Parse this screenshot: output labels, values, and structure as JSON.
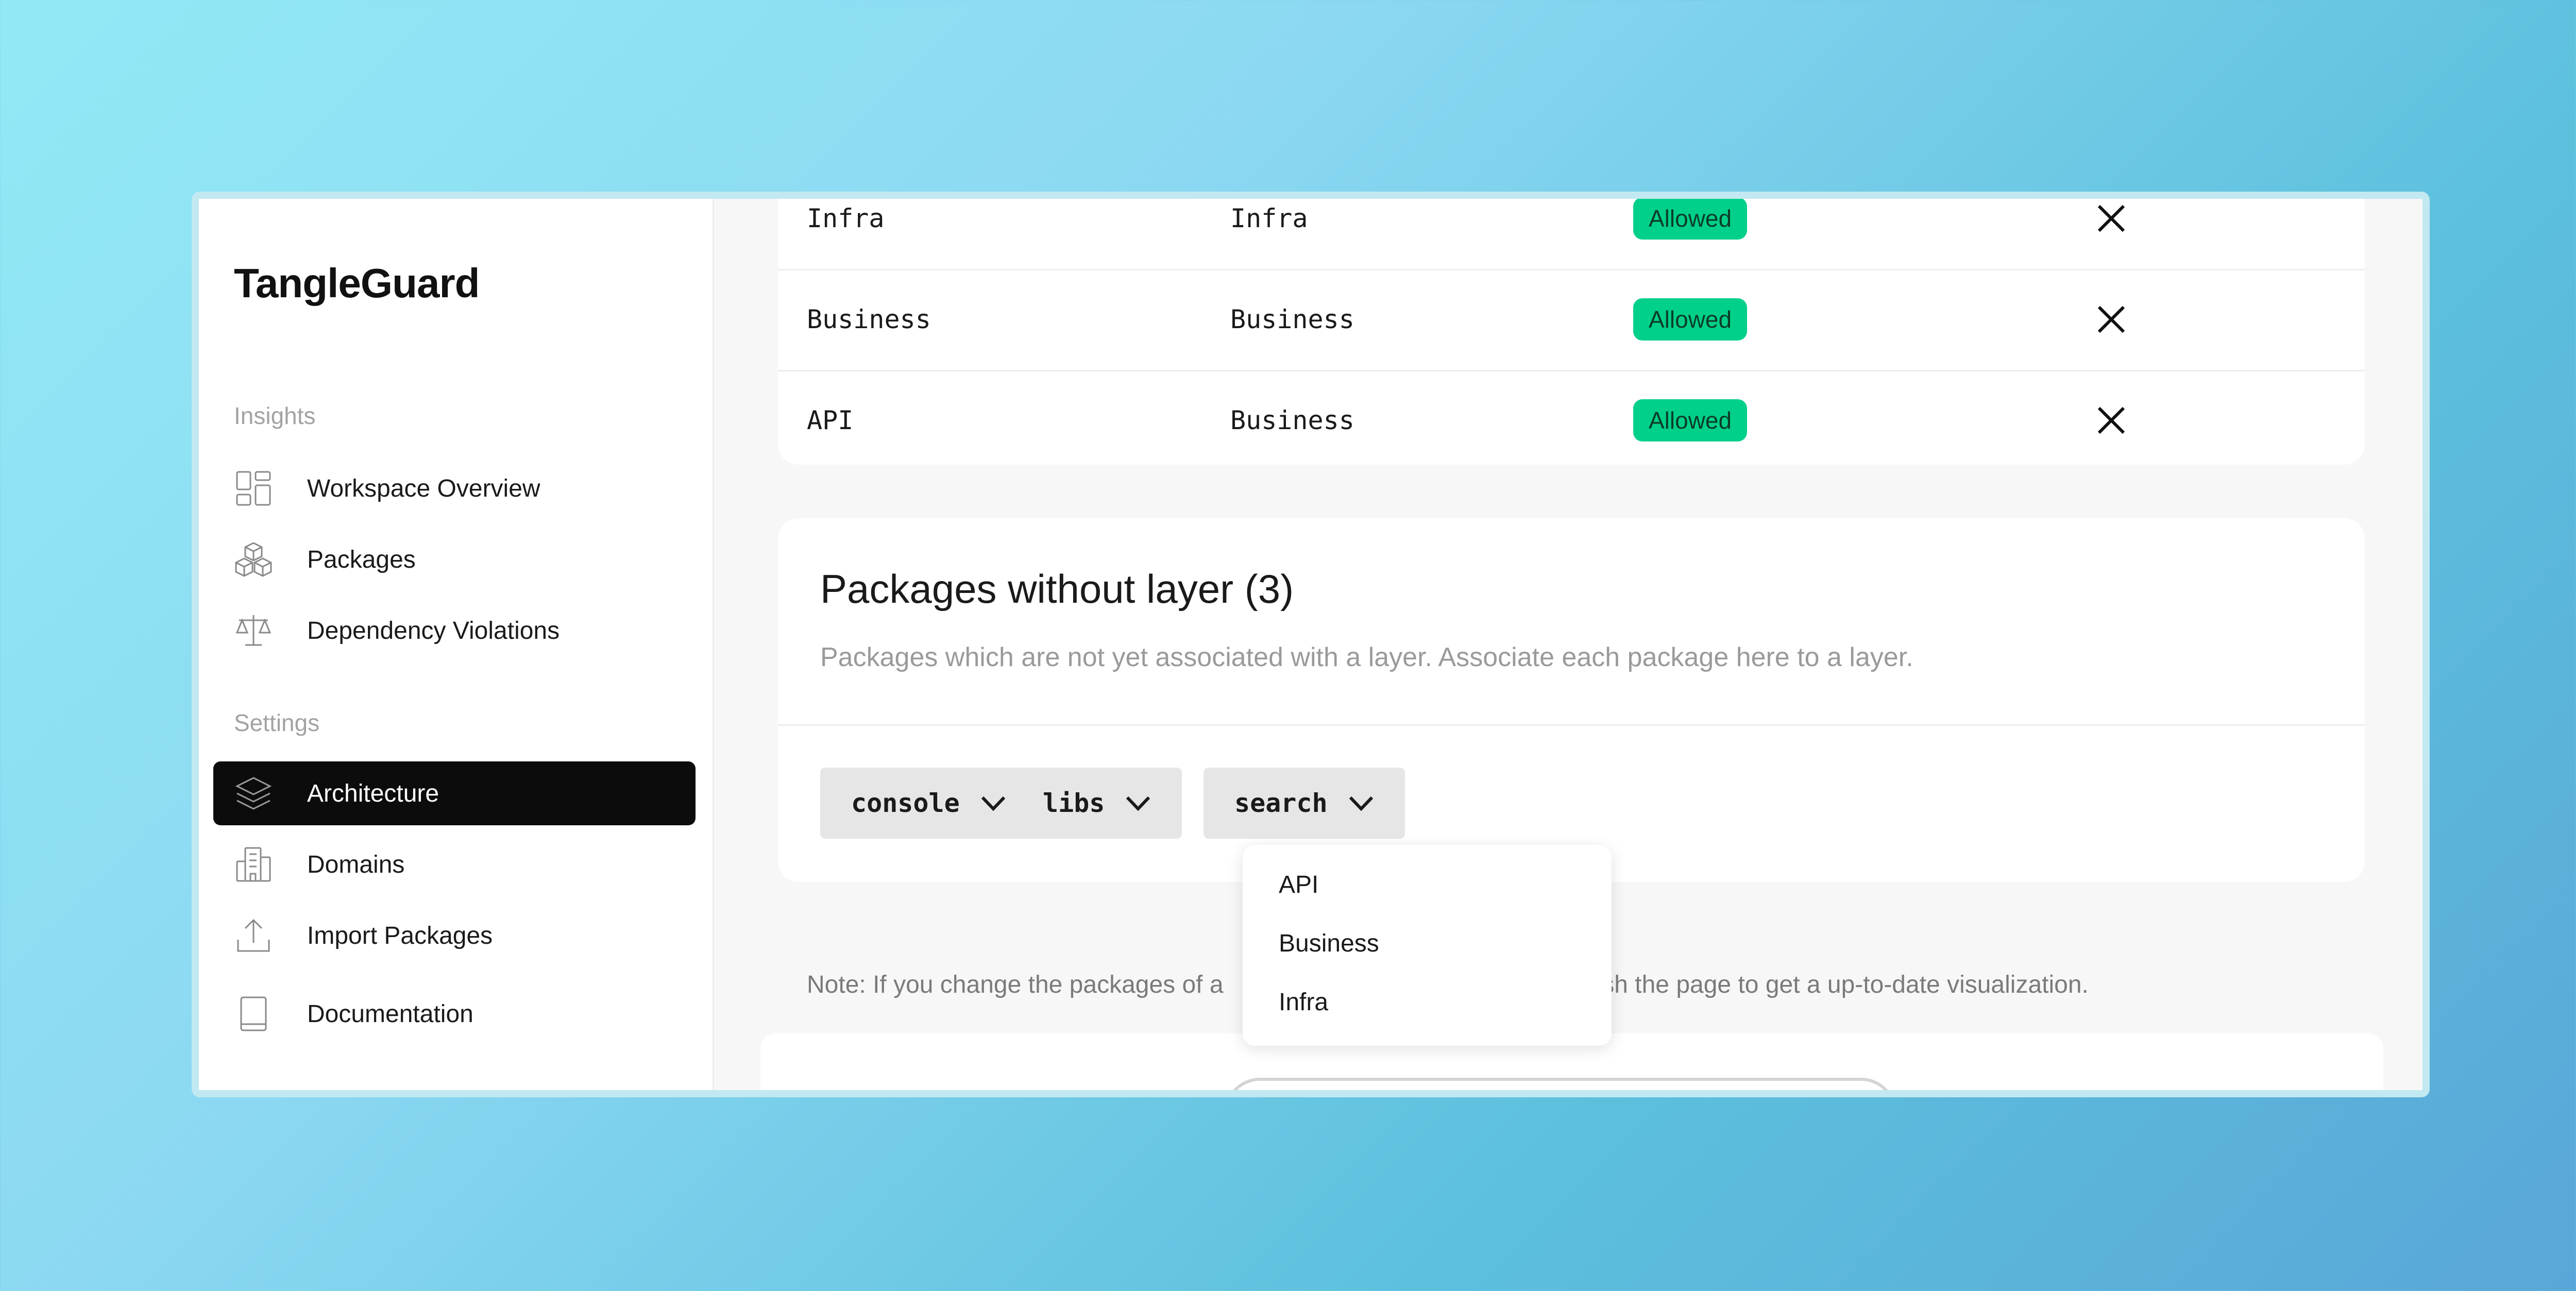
{
  "app": {
    "name": "TangleGuard"
  },
  "sidebar": {
    "sections": [
      {
        "title": "Insights",
        "items": [
          {
            "label": "Workspace Overview",
            "icon": "grid-layout-icon"
          },
          {
            "label": "Packages",
            "icon": "cubes-icon"
          },
          {
            "label": "Dependency Violations",
            "icon": "scale-icon"
          }
        ]
      },
      {
        "title": "Settings",
        "items": [
          {
            "label": "Architecture",
            "icon": "layers-icon",
            "active": true
          },
          {
            "label": "Domains",
            "icon": "building-icon"
          },
          {
            "label": "Import Packages",
            "icon": "upload-icon"
          },
          {
            "label": "Documentation",
            "icon": "book-icon"
          }
        ]
      }
    ]
  },
  "rules_table": {
    "rows": [
      {
        "from": "Infra",
        "to": "Infra",
        "status": "Allowed"
      },
      {
        "from": "Business",
        "to": "Business",
        "status": "Allowed"
      },
      {
        "from": "API",
        "to": "Business",
        "status": "Allowed"
      }
    ]
  },
  "packages_without_layer": {
    "title": "Packages without layer (3)",
    "description": "Packages which are not yet associated with a layer. Associate each package here to a layer.",
    "packages": [
      "console",
      "libs",
      "search"
    ]
  },
  "layer_dropdown": {
    "options": [
      "API",
      "Business",
      "Infra"
    ]
  },
  "note": {
    "left": "Note: If you change the packages of a",
    "right": "esh the page to get a up-to-date visualization."
  },
  "colors": {
    "accent_badge": "#00d08a",
    "active_nav": "#0c0c0c"
  }
}
